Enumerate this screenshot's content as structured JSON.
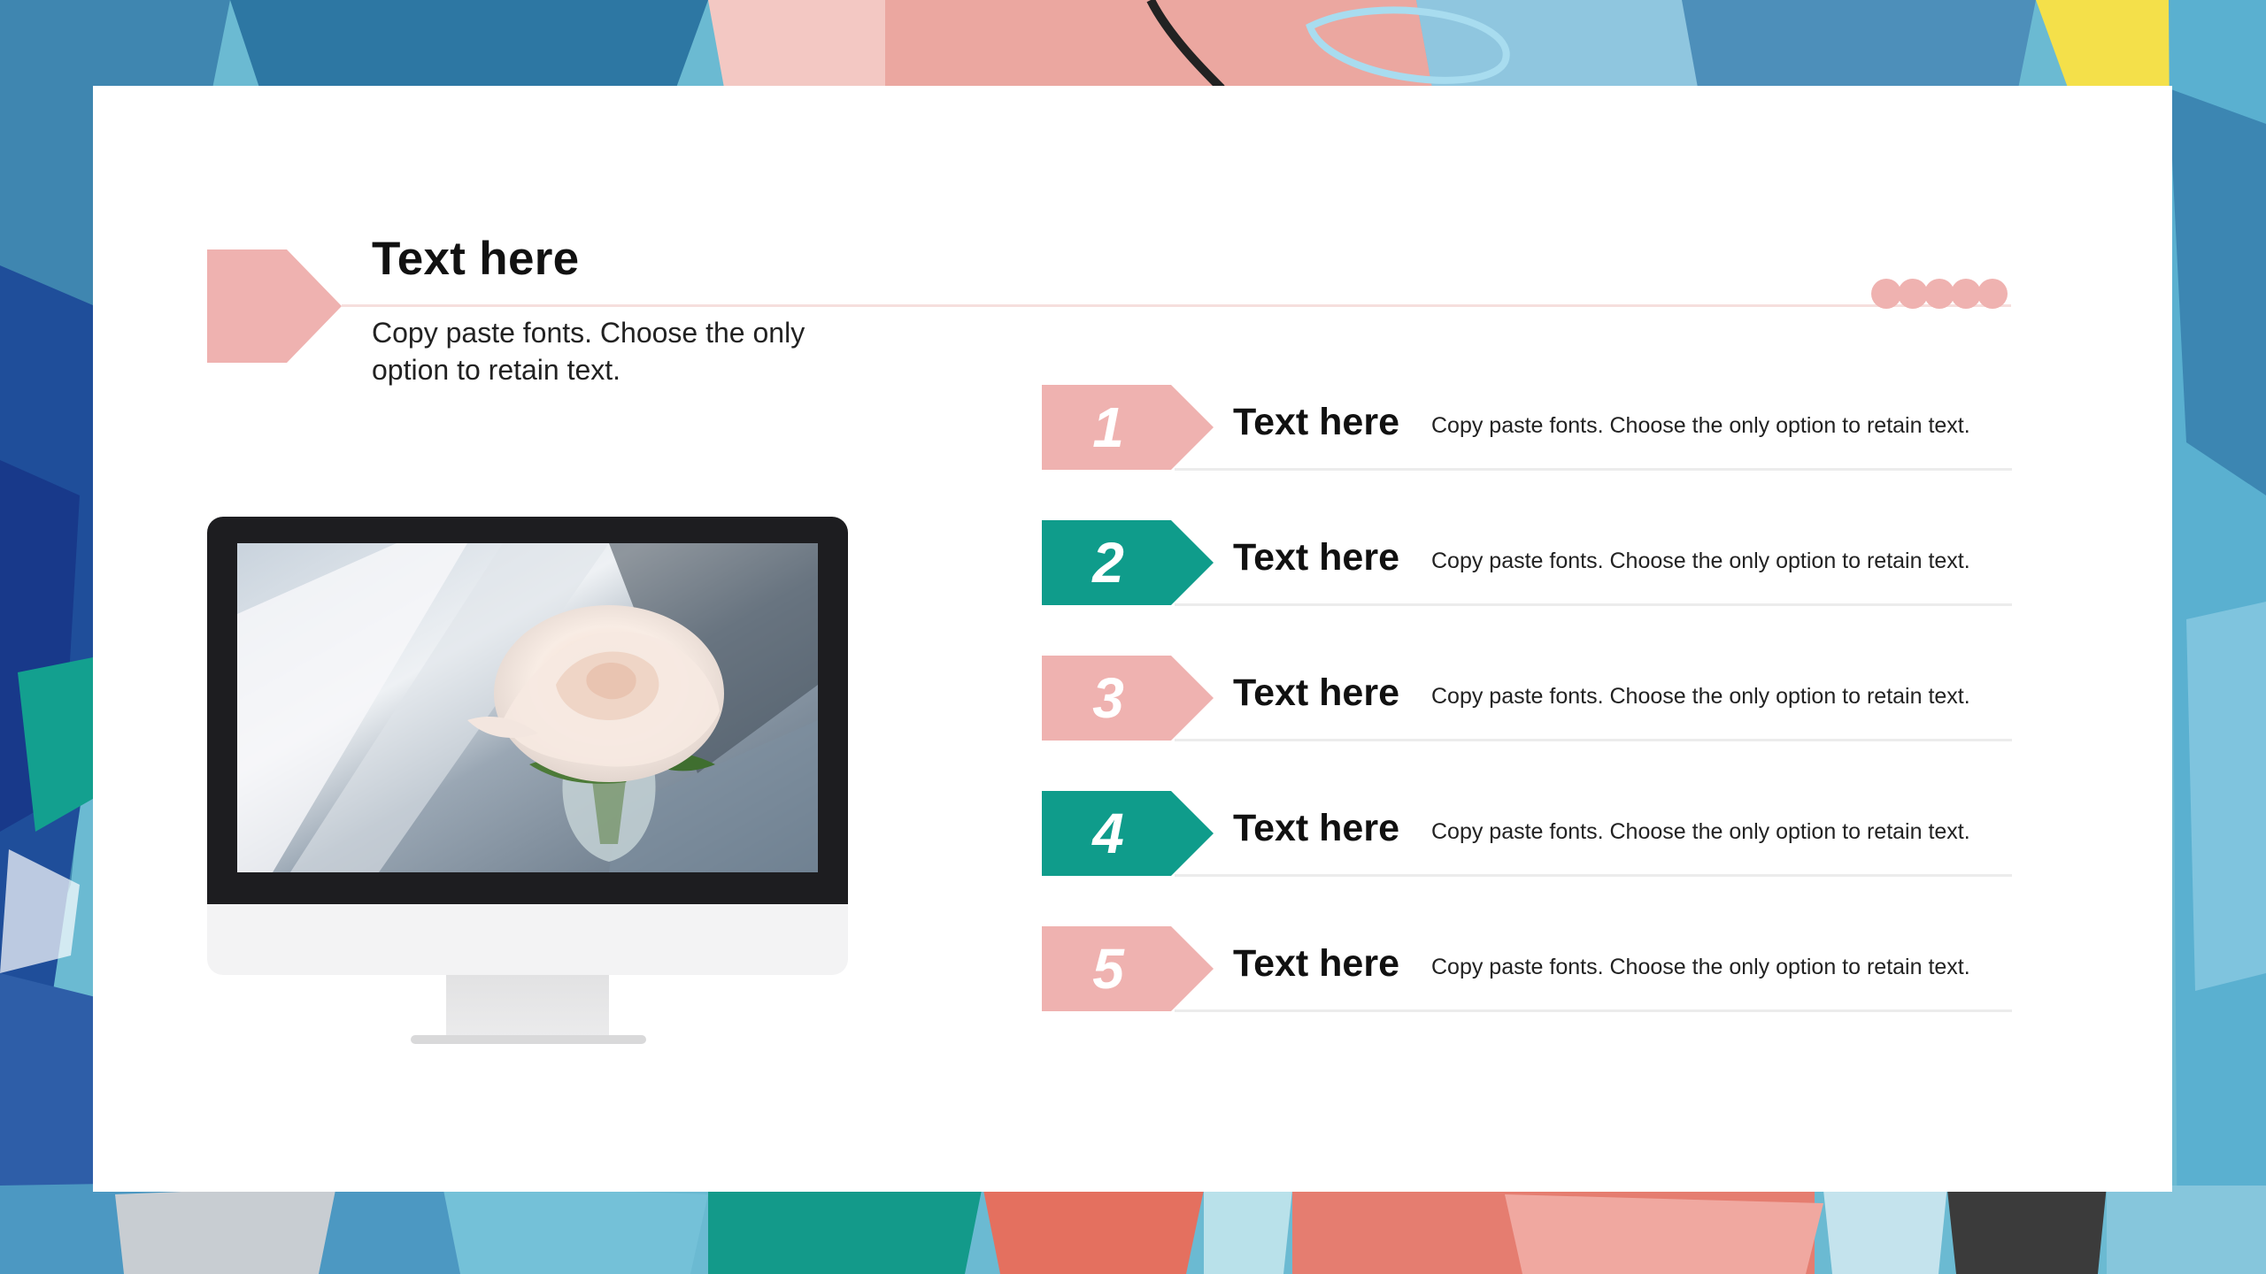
{
  "colors": {
    "pink": "#efb2b0",
    "teal": "#0f9c8b",
    "card": "#ffffff"
  },
  "header": {
    "title": "Text here",
    "description": "Copy paste fonts. Choose the only option to retain text."
  },
  "items": [
    {
      "number": "1",
      "title": "Text here",
      "description": "Copy paste fonts. Choose the only option to retain text.",
      "color": "pink"
    },
    {
      "number": "2",
      "title": "Text here",
      "description": "Copy paste fonts. Choose the only option to retain text.",
      "color": "teal"
    },
    {
      "number": "3",
      "title": "Text here",
      "description": "Copy paste fonts. Choose the only option to retain text.",
      "color": "pink"
    },
    {
      "number": "4",
      "title": "Text here",
      "description": "Copy paste fonts. Choose the only option to retain text.",
      "color": "teal"
    },
    {
      "number": "5",
      "title": "Text here",
      "description": "Copy paste fonts. Choose the only option to retain text.",
      "color": "pink"
    }
  ],
  "image": {
    "subject": "white-rose-photo"
  }
}
